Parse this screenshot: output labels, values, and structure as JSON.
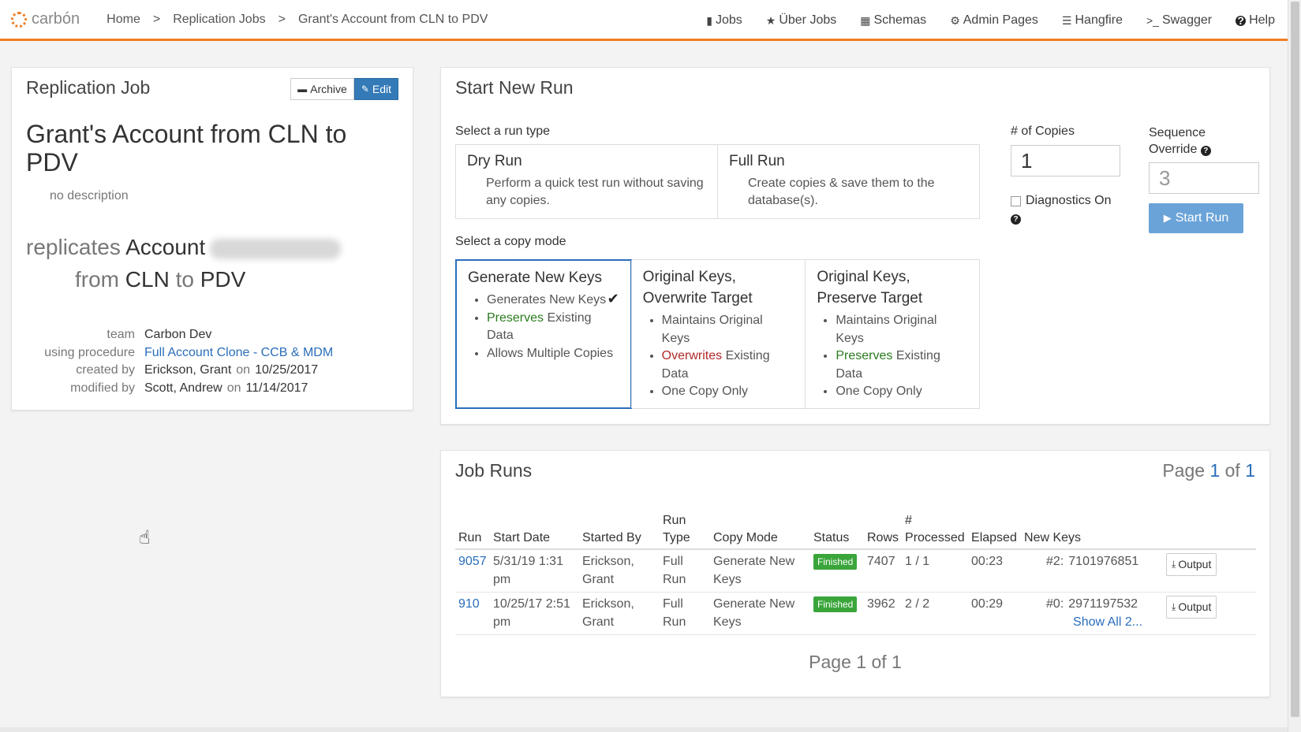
{
  "nav": {
    "brand": "carbón",
    "breadcrumb": [
      "Home",
      "Replication Jobs",
      "Grant's Account from CLN to PDV"
    ],
    "links": [
      {
        "icon": "briefcase-icon",
        "glyph": "▮",
        "label": "Jobs"
      },
      {
        "icon": "star-icon",
        "glyph": "★",
        "label": "Über Jobs"
      },
      {
        "icon": "table-icon",
        "glyph": "▦",
        "label": "Schemas"
      },
      {
        "icon": "cogs-icon",
        "glyph": "⚙",
        "label": "Admin Pages"
      },
      {
        "icon": "tasks-icon",
        "glyph": "☰",
        "label": "Hangfire"
      },
      {
        "icon": "terminal-icon",
        "glyph": ">_",
        "label": "Swagger"
      },
      {
        "icon": "question-icon",
        "glyph": "?",
        "label": "Help"
      }
    ]
  },
  "job": {
    "panel_title": "Replication Job",
    "archive_label": "Archive",
    "edit_label": "Edit",
    "title": "Grant's Account from CLN to PDV",
    "description": "no description",
    "replicates_word": "replicates",
    "entity": "Account",
    "from_word": "from",
    "source": "CLN",
    "to_word": "to",
    "target": "PDV",
    "meta": {
      "team_label": "team",
      "team": "Carbon Dev",
      "procedure_label": "using procedure",
      "procedure": "Full Account Clone - CCB & MDM",
      "created_label": "created by",
      "created_by": "Erickson, Grant",
      "created_on_word": "on",
      "created_on": "10/25/2017",
      "modified_label": "modified by",
      "modified_by": "Scott, Andrew",
      "modified_on_word": "on",
      "modified_on": "11/14/2017"
    }
  },
  "run": {
    "panel_title": "Start New Run",
    "run_type_label": "Select a run type",
    "types": [
      {
        "title": "Dry Run",
        "desc": "Perform a quick test run without saving any copies."
      },
      {
        "title": "Full Run",
        "desc": "Create copies & save them to the database(s)."
      }
    ],
    "copy_mode_label": "Select a copy mode",
    "modes": {
      "m0": {
        "title": "Generate New Keys",
        "b1": "Generates New Keys",
        "b2_em": "Preserves",
        "b2_rest": " Existing Data",
        "b3": "Allows Multiple Copies"
      },
      "m1": {
        "title": "Original Keys, Overwrite Target",
        "b1": "Maintains Original Keys",
        "b2_em": "Overwrites",
        "b2_rest": " Existing Data",
        "b3": "One Copy Only"
      },
      "m2": {
        "title": "Original Keys, Preserve Target",
        "b1": "Maintains Original Keys",
        "b2_em": "Preserves",
        "b2_rest": " Existing Data",
        "b3": "One Copy Only"
      }
    },
    "copies_label": "# of Copies",
    "copies_value": "1",
    "sequence_label": "Sequence Override",
    "sequence_value": "3",
    "diagnostics_label": "Diagnostics On",
    "start_label": "Start Run"
  },
  "runs": {
    "panel_title": "Job Runs",
    "page_prefix": "Page",
    "page_current": "1",
    "page_of": "of",
    "page_total": "1",
    "page_bottom": "Page 1 of 1",
    "columns": {
      "run": "Run",
      "start": "Start Date",
      "by": "Started By",
      "type": "Run Type",
      "mode": "Copy Mode",
      "status": "Status",
      "rows": "Rows",
      "processed": "# Processed",
      "elapsed": "Elapsed",
      "keys": "New Keys"
    },
    "rows": [
      {
        "run": "9057",
        "start": "5/31/19 1:31 pm",
        "by": "Erickson, Grant",
        "type": "Full Run",
        "mode": "Generate New Keys",
        "status": "Finished",
        "rows": "7407",
        "processed": "1 / 1",
        "elapsed": "00:23",
        "key_idx": "#2:",
        "key": "7101976851",
        "show_all": "",
        "output": "Output"
      },
      {
        "run": "910",
        "start": "10/25/17 2:51 pm",
        "by": "Erickson, Grant",
        "type": "Full Run",
        "mode": "Generate New Keys",
        "status": "Finished",
        "rows": "3962",
        "processed": "2 / 2",
        "elapsed": "00:29",
        "key_idx": "#0:",
        "key": "2971197532",
        "show_all": "Show All 2...",
        "output": "Output"
      }
    ]
  },
  "colors": {
    "accent": "#f07d22",
    "link": "#2a6ebb",
    "primary": "#337ab7",
    "success": "#3aa53a"
  }
}
